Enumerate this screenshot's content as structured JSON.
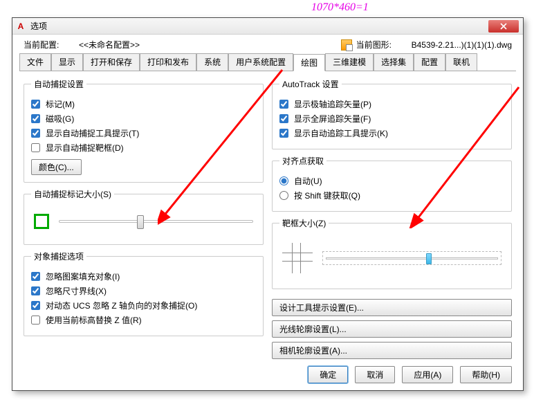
{
  "annotation": "1070*460=1",
  "titlebar": {
    "logo": "A",
    "title": "选项"
  },
  "configRow": {
    "currentConfigLabel": "当前配置:",
    "currentConfigValue": "<<未命名配置>>",
    "currentDrawingLabel": "当前图形:",
    "currentDrawingValue": "B4539-2.21...)(1)(1)(1).dwg"
  },
  "tabs": [
    "文件",
    "显示",
    "打开和保存",
    "打印和发布",
    "系统",
    "用户系统配置",
    "绘图",
    "三维建模",
    "选择集",
    "配置",
    "联机"
  ],
  "activeTab": 6,
  "groups": {
    "autoSnap": {
      "legend": "自动捕捉设置",
      "marker": "标记(M)",
      "magnet": "磁吸(G)",
      "showTips": "显示自动捕捉工具提示(T)",
      "showAperture": "显示自动捕捉靶框(D)",
      "colorBtn": "颜色(C)..."
    },
    "markerSize": {
      "legend": "自动捕捉标记大小(S)"
    },
    "osnapOptions": {
      "legend": "对象捕捉选项",
      "ignoreHatch": "忽略图案填充对象(I)",
      "ignoreDimExt": "忽略尺寸界线(X)",
      "dynamicUcs": "对动态 UCS 忽略 Z 轴负向的对象捕捉(O)",
      "useElevation": "使用当前标高替换 Z 值(R)"
    },
    "autoTrack": {
      "legend": "AutoTrack 设置",
      "polar": "显示极轴追踪矢量(P)",
      "fullscreen": "显示全屏追踪矢量(F)",
      "tooltips": "显示自动追踪工具提示(K)"
    },
    "alignment": {
      "legend": "对齐点获取",
      "auto": "自动(U)",
      "shift": "按 Shift 键获取(Q)"
    },
    "aperture": {
      "legend": "靶框大小(Z)"
    },
    "buttons": {
      "designTooltip": "设计工具提示设置(E)...",
      "lightGlyph": "光线轮廓设置(L)...",
      "cameraGlyph": "相机轮廓设置(A)..."
    }
  },
  "bottom": {
    "ok": "确定",
    "cancel": "取消",
    "apply": "应用(A)",
    "help": "帮助(H)"
  }
}
